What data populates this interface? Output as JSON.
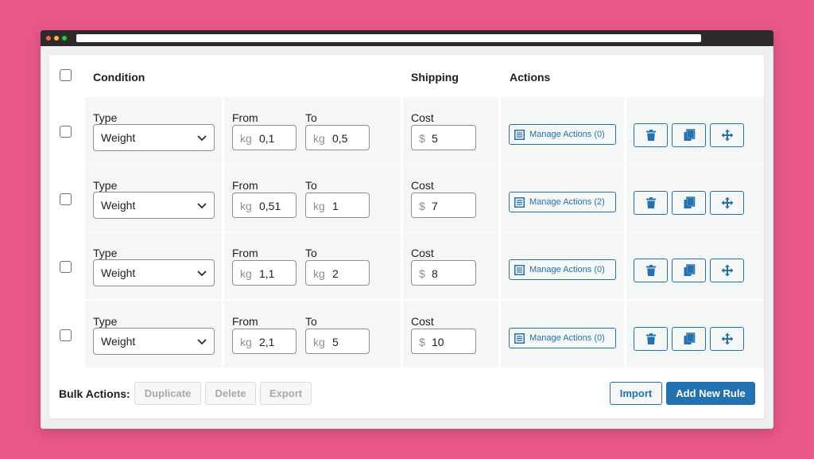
{
  "colors": {
    "background": "#e8578a",
    "accent": "#2271b1",
    "row_bg": "#f5f6f6"
  },
  "table": {
    "headers": {
      "condition": "Condition",
      "shipping": "Shipping",
      "actions": "Actions"
    },
    "rows": [
      {
        "type_label": "Type",
        "type_value": "Weight",
        "from_label": "From",
        "from_unit": "kg",
        "from_value": "0,1",
        "to_label": "To",
        "to_unit": "kg",
        "to_value": "0,5",
        "cost_label": "Cost",
        "cost_unit": "$",
        "cost_value": "5",
        "manage_label": "Manage Actions (0)"
      },
      {
        "type_label": "Type",
        "type_value": "Weight",
        "from_label": "From",
        "from_unit": "kg",
        "from_value": "0,51",
        "to_label": "To",
        "to_unit": "kg",
        "to_value": "1",
        "cost_label": "Cost",
        "cost_unit": "$",
        "cost_value": "7",
        "manage_label": "Manage Actions (2)"
      },
      {
        "type_label": "Type",
        "type_value": "Weight",
        "from_label": "From",
        "from_unit": "kg",
        "from_value": "1,1",
        "to_label": "To",
        "to_unit": "kg",
        "to_value": "2",
        "cost_label": "Cost",
        "cost_unit": "$",
        "cost_value": "8",
        "manage_label": "Manage Actions (0)"
      },
      {
        "type_label": "Type",
        "type_value": "Weight",
        "from_label": "From",
        "from_unit": "kg",
        "from_value": "2,1",
        "to_label": "To",
        "to_unit": "kg",
        "to_value": "5",
        "cost_label": "Cost",
        "cost_unit": "$",
        "cost_value": "10",
        "manage_label": "Manage Actions (0)"
      }
    ],
    "row_icons": [
      "trash-icon",
      "duplicate-icon",
      "move-icon"
    ]
  },
  "footer": {
    "bulk_label": "Bulk Actions:",
    "duplicate_label": "Duplicate",
    "delete_label": "Delete",
    "export_label": "Export",
    "import_label": "Import",
    "add_rule_label": "Add New Rule"
  }
}
